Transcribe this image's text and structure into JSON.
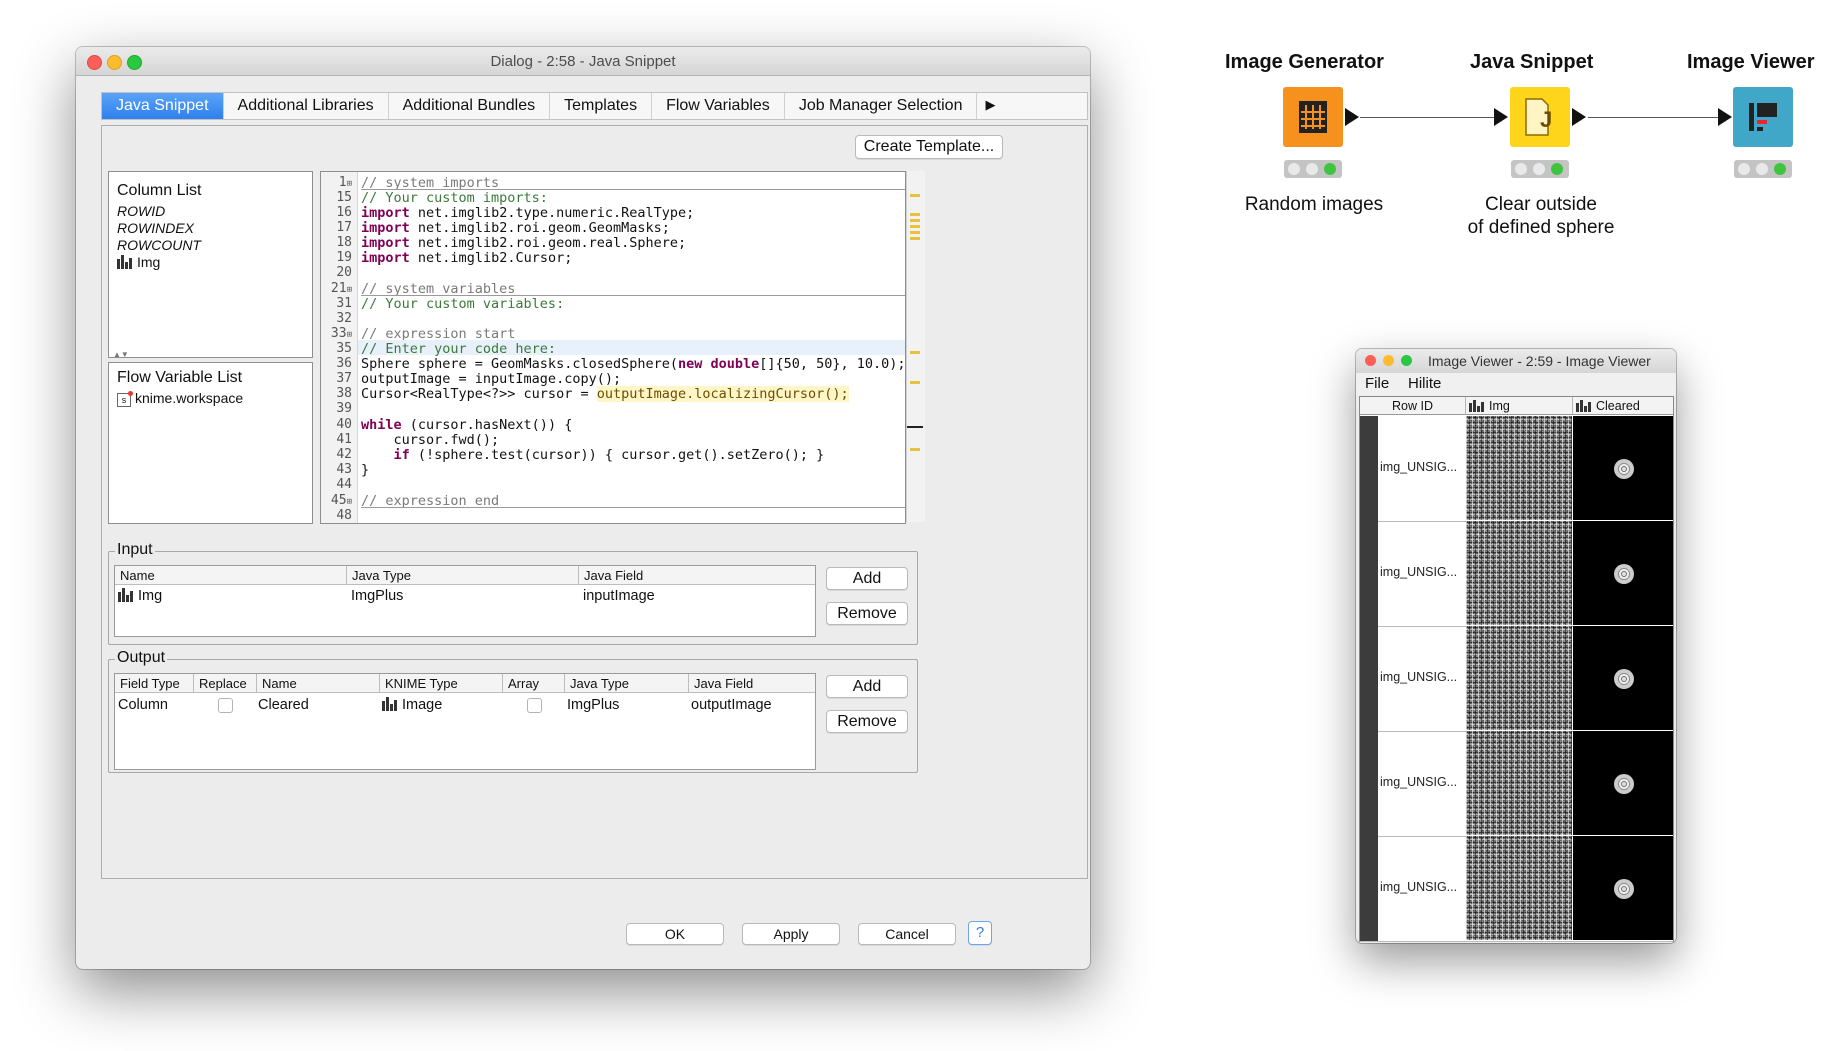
{
  "dialog": {
    "title": "Dialog - 2:58 - Java Snippet",
    "tabs": [
      "Java Snippet",
      "Additional Libraries",
      "Additional Bundles",
      "Templates",
      "Flow Variables",
      "Job Manager Selection"
    ],
    "create_template": "Create Template...",
    "column_list": {
      "title": "Column List",
      "items": [
        "ROWID",
        "ROWINDEX",
        "ROWCOUNT",
        "Img"
      ]
    },
    "flow_variable_list": {
      "title": "Flow Variable List",
      "items": [
        "knime.workspace"
      ]
    },
    "code": {
      "ln1": "1",
      "l1": "// system imports",
      "ln15": "15",
      "l15": "// Your custom imports:",
      "ln16": "16",
      "l16": "net.imglib2.type.numeric.RealType;",
      "ln17": "17",
      "l17": "net.imglib2.roi.geom.GeomMasks;",
      "ln18": "18",
      "l18": "net.imglib2.roi.geom.real.Sphere;",
      "ln19": "19",
      "l19": "net.imglib2.Cursor;",
      "ln20": "20",
      "ln21": "21",
      "l21": "// system variables",
      "ln31": "31",
      "l31": "// Your custom variables:",
      "ln32": "32",
      "ln33": "33",
      "l33": "// expression start",
      "ln35": "35",
      "l35": "// Enter your code here:",
      "ln36": "36",
      "l36a": "Sphere sphere = GeomMasks.closedSphere(",
      "l36b": "new double",
      "l36c": "[]{50, 50}, 10.0);",
      "ln37": "37",
      "l37": "outputImage = inputImage.copy();",
      "ln38": "38",
      "l38a": "Cursor<RealType<?>> cursor = ",
      "l38b": "outputImage.localizingCursor();",
      "ln39": "39",
      "ln40": "40",
      "l40a": "while",
      "l40b": " (cursor.hasNext()) {",
      "ln41": "41",
      "l41": "    cursor.fwd();",
      "ln42": "42",
      "l42a": "    ",
      "l42b": "if",
      "l42c": " (!sphere.test(cursor)) { cursor.get().setZero(); }",
      "ln43": "43",
      "l43": "}",
      "ln44": "44",
      "ln45": "45",
      "l45": "// expression end",
      "ln48": "48",
      "kw_import": "import"
    },
    "input": {
      "title": "Input",
      "headers": [
        "Name",
        "Java Type",
        "Java Field"
      ],
      "row": [
        "Img",
        "ImgPlus",
        "inputImage"
      ],
      "add": "Add",
      "remove": "Remove"
    },
    "output": {
      "title": "Output",
      "headers": [
        "Field Type",
        "Replace",
        "Name",
        "KNIME Type",
        "Array",
        "Java Type",
        "Java Field"
      ],
      "row": [
        "Column",
        "",
        "Cleared",
        "Image",
        "",
        "ImgPlus",
        "outputImage"
      ],
      "add": "Add",
      "remove": "Remove"
    },
    "buttons": {
      "ok": "OK",
      "apply": "Apply",
      "cancel": "Cancel",
      "help": "?"
    }
  },
  "workflow": {
    "nodes": [
      {
        "title": "Image Generator",
        "label": "Random images",
        "color": "#f7911e"
      },
      {
        "title": "Java Snippet",
        "label1": "Clear outside",
        "label2": "of defined sphere",
        "color": "#ffd51c"
      },
      {
        "title": "Image Viewer",
        "label": "",
        "color": "#40a7c9"
      }
    ]
  },
  "viewer": {
    "title": "Image Viewer - 2:59 - Image Viewer",
    "menu": [
      "File",
      "Hilite"
    ],
    "headers": [
      "Row ID",
      "Img",
      "Cleared"
    ],
    "rows": [
      "img_UNSIG...",
      "img_UNSIG...",
      "img_UNSIG...",
      "img_UNSIG...",
      "img_UNSIG..."
    ]
  }
}
